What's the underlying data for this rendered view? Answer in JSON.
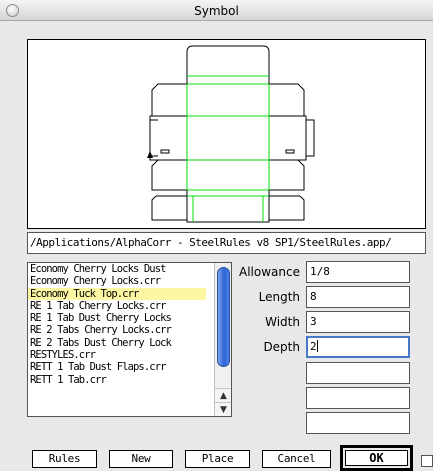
{
  "window": {
    "title": "Symbol"
  },
  "path": "/Applications/AlphaCorr - SteelRules v8 SP1/SteelRules.app/",
  "list": {
    "items": [
      {
        "label": "Economy Cherry Locks Dust"
      },
      {
        "label": "Economy Cherry Locks.crr"
      },
      {
        "label": "Economy Tuck Top.crr",
        "selected": true
      },
      {
        "label": "RE 1 Tab Cherry Locks.crr"
      },
      {
        "label": "RE 1 Tab Dust Cherry Locks"
      },
      {
        "label": "RE 2 Tabs Cherry Locks.crr"
      },
      {
        "label": "RE 2 Tabs Dust Cherry Lock"
      },
      {
        "label": "RESTYLES.crr"
      },
      {
        "label": "RETT 1 Tab Dust Flaps.crr"
      },
      {
        "label": "RETT 1 Tab.crr"
      }
    ],
    "scroll_up_icon": "up-arrow",
    "scroll_down_icon": "down-arrow"
  },
  "fields": {
    "allowance": {
      "label": "Allowance",
      "value": "1/8"
    },
    "length": {
      "label": "Length",
      "value": "8"
    },
    "width": {
      "label": "Width",
      "value": "3"
    },
    "depth": {
      "label": "Depth",
      "value": "2"
    },
    "extra1": {
      "value": ""
    },
    "extra2": {
      "value": ""
    },
    "extra3": {
      "value": ""
    }
  },
  "buttons": {
    "rules": "Rules",
    "new": "New",
    "place": "Place",
    "cancel": "Cancel",
    "ok": "OK"
  },
  "colors": {
    "preview_fold_lines": "#00dd00",
    "selected_row": "#fdf7a4",
    "scroll_thumb": "#2c64d8"
  }
}
